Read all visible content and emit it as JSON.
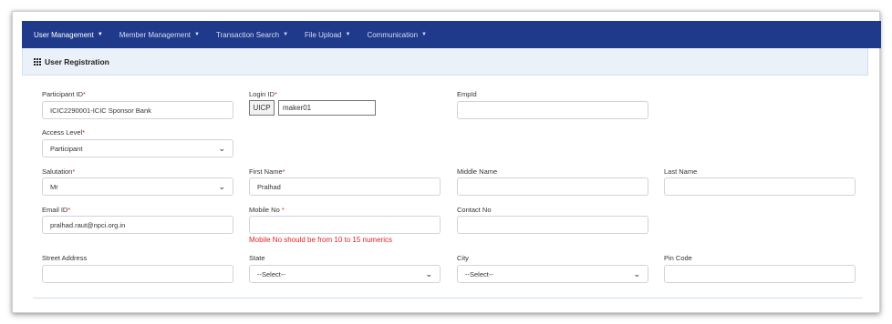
{
  "nav": {
    "items": [
      {
        "label": "User Management"
      },
      {
        "label": "Member Management"
      },
      {
        "label": "Transaction Search"
      },
      {
        "label": "File Upload"
      },
      {
        "label": "Communication"
      }
    ]
  },
  "panel": {
    "title": "User Registration"
  },
  "form": {
    "participant_id": {
      "label": "Participant ID",
      "required_mark": "*",
      "value": "ICIC2290001-ICIC Sponsor Bank"
    },
    "login_id": {
      "label": "Login ID",
      "required_mark": "*",
      "prefix": "UICP",
      "value": "maker01"
    },
    "emp_id": {
      "label": "EmpId",
      "value": ""
    },
    "access_level": {
      "label": "Access Level",
      "required_mark": "*",
      "value": "Participant"
    },
    "salutation": {
      "label": "Salutation",
      "required_mark": "*",
      "value": "Mr"
    },
    "first_name": {
      "label": "First Name",
      "required_mark": "*",
      "value": "Pralhad"
    },
    "middle_name": {
      "label": "Middle Name",
      "value": ""
    },
    "last_name": {
      "label": "Last Name",
      "value": ""
    },
    "email_id": {
      "label": "Email ID",
      "required_mark": "*",
      "value": "pralhad.raut@npci.org.in"
    },
    "mobile_no": {
      "label": "Mobile No ",
      "required_mark": "*",
      "value": "",
      "error": "Mobile No should be from 10 to 15 numerics"
    },
    "contact_no": {
      "label": "Contact No",
      "value": ""
    },
    "street_address": {
      "label": "Street Address",
      "value": ""
    },
    "state": {
      "label": "State",
      "value": "--Select--"
    },
    "city": {
      "label": "City",
      "value": "--Select--"
    },
    "pin_code": {
      "label": "Pin Code",
      "value": ""
    }
  },
  "icons": {
    "caret": "caret-down-icon",
    "grid": "grid-icon",
    "chevron": "chevron-down-icon"
  }
}
